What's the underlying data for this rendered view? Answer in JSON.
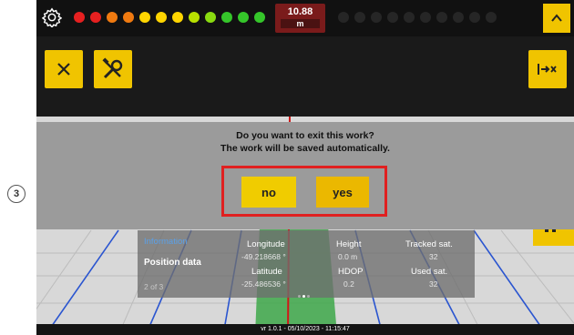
{
  "annotation": {
    "step_number": "3"
  },
  "topbar": {
    "distance_value": "10.88",
    "distance_unit": "m",
    "leds": [
      "#e62020",
      "#e62020",
      "#f07a10",
      "#f07a10",
      "#ffd500",
      "#ffd500",
      "#ffd500",
      "#b8e000",
      "#8adb10",
      "#35c62a",
      "#35c62a",
      "#35c62a",
      "#262626",
      "#262626",
      "#262626",
      "#262626",
      "#262626",
      "#262626",
      "#262626",
      "#262626",
      "#262626",
      "#262626"
    ]
  },
  "dialog": {
    "line1": "Do you want to exit this work?",
    "line2": "The work will be saved automatically.",
    "no_label": "no",
    "yes_label": "yes"
  },
  "info_panel": {
    "tab_label": "Information",
    "section_label": "Position data",
    "page_indicator": "2 of 3",
    "fields": [
      {
        "label": "Longitude",
        "value": "-49.218668 °"
      },
      {
        "label": "Height",
        "value": "0.0 m"
      },
      {
        "label": "Tracked sat.",
        "value": "32"
      },
      {
        "label": "Latitude",
        "value": "-25.486536 °"
      },
      {
        "label": "HDOP",
        "value": "0.2"
      },
      {
        "label": "Used sat.",
        "value": "32"
      }
    ]
  },
  "footer": {
    "version_text": "vr 1.0.1 - 05/10/2023 - 11:15:47"
  },
  "colors": {
    "accent": "#f0c400",
    "alert_frame": "#e02020"
  }
}
